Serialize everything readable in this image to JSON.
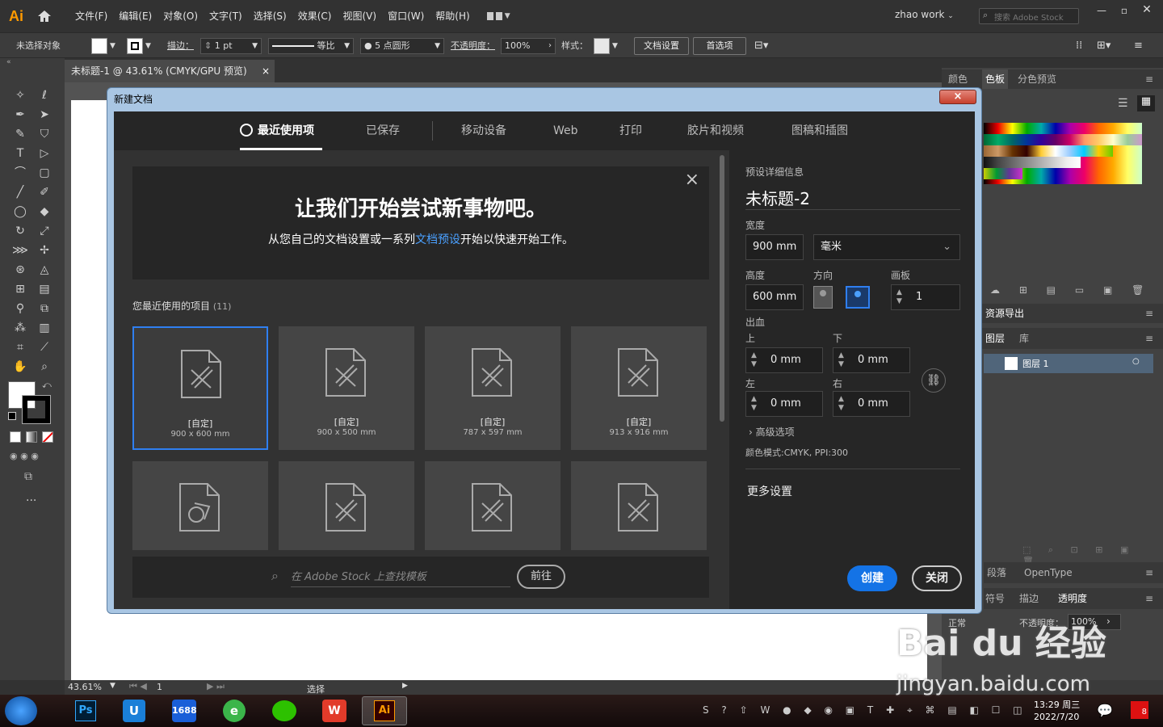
{
  "app": {
    "logo": "Ai"
  },
  "menubar": {
    "items": [
      "文件(F)",
      "编辑(E)",
      "对象(O)",
      "文字(T)",
      "选择(S)",
      "效果(C)",
      "视图(V)",
      "窗口(W)",
      "帮助(H)"
    ],
    "user": "zhao work",
    "search_placeholder": "搜索 Adobe Stock"
  },
  "control": {
    "no_selection": "未选择对象",
    "stroke_label": "描边：",
    "stroke_value": "1 pt",
    "profile": "等比",
    "brush": "5 点圆形",
    "opacity_label": "不透明度：",
    "opacity_value": "100%",
    "style_label": "样式：",
    "doc_setup": "文档设置",
    "preferences": "首选项"
  },
  "doc_tab": {
    "title": "未标题-1 @ 43.61% (CMYK/GPU 预览)",
    "close": "×"
  },
  "toolbox": {
    "more": "···"
  },
  "right_panels": {
    "top_tabs": [
      "颜色",
      "色板",
      "分色预览"
    ],
    "asset_export": "资源导出",
    "layers_tabs": [
      "图层",
      "库"
    ],
    "layer_name": "图层 1",
    "type_tabs": [
      "段落",
      "OpenType"
    ],
    "trans_tabs": [
      "符号",
      "描边",
      "透明度"
    ],
    "blend": "正常",
    "opacity_label": "不透明度：",
    "opacity_value": "100%"
  },
  "status": {
    "zoom": "43.61%",
    "page": "1",
    "tool": "选择"
  },
  "taskbar": {
    "apps": [
      "Ps",
      "U",
      "1688",
      "e",
      "WeChat",
      "WPS",
      "Ai"
    ],
    "time": "13:29 周三",
    "date": "2022/7/20",
    "notif_count": "8"
  },
  "dialog": {
    "title": "新建文档",
    "close": "×",
    "tabs": [
      "最近使用项",
      "已保存",
      "移动设备",
      "Web",
      "打印",
      "胶片和视频",
      "图稿和插图"
    ],
    "hero_title": "让我们开始尝试新事物吧。",
    "hero_sub_before": "从您自己的文档设置或一系列",
    "hero_link": "文档预设",
    "hero_sub_after": "开始以快速开始工作。",
    "hero_close": "×",
    "recent_label": "您最近使用的项目",
    "recent_count": "(11)",
    "cards": [
      {
        "name": "[自定]",
        "size": "900 x 600 mm"
      },
      {
        "name": "[自定]",
        "size": "900 x 500 mm"
      },
      {
        "name": "[自定]",
        "size": "787 x 597 mm"
      },
      {
        "name": "[自定]",
        "size": "913 x 916 mm"
      }
    ],
    "stock_placeholder": "在 Adobe Stock 上查找模板",
    "go_button": "前往",
    "preset": {
      "header": "预设详细信息",
      "name": "未标题-2",
      "width_label": "宽度",
      "width": "900 mm",
      "unit": "毫米",
      "height_label": "高度",
      "height": "600 mm",
      "orientation_label": "方向",
      "artboards_label": "画板",
      "artboards": "1",
      "bleed_label": "出血",
      "top_label": "上",
      "bottom_label": "下",
      "left_label": "左",
      "right_label": "右",
      "bleed_top": "0 mm",
      "bleed_bottom": "0 mm",
      "bleed_left": "0 mm",
      "bleed_right": "0 mm",
      "advanced": "高级选项",
      "color_mode": "颜色模式:CMYK, PPI:300",
      "more_settings": "更多设置",
      "create": "创建",
      "close": "关闭"
    }
  },
  "watermark": {
    "text": "Bai du 经验",
    "url": "jingyan.baidu.com"
  },
  "colors": {
    "accent": "#2f7ff0",
    "create_btn": "#1473e6",
    "ai_orange": "#ff9a00"
  }
}
